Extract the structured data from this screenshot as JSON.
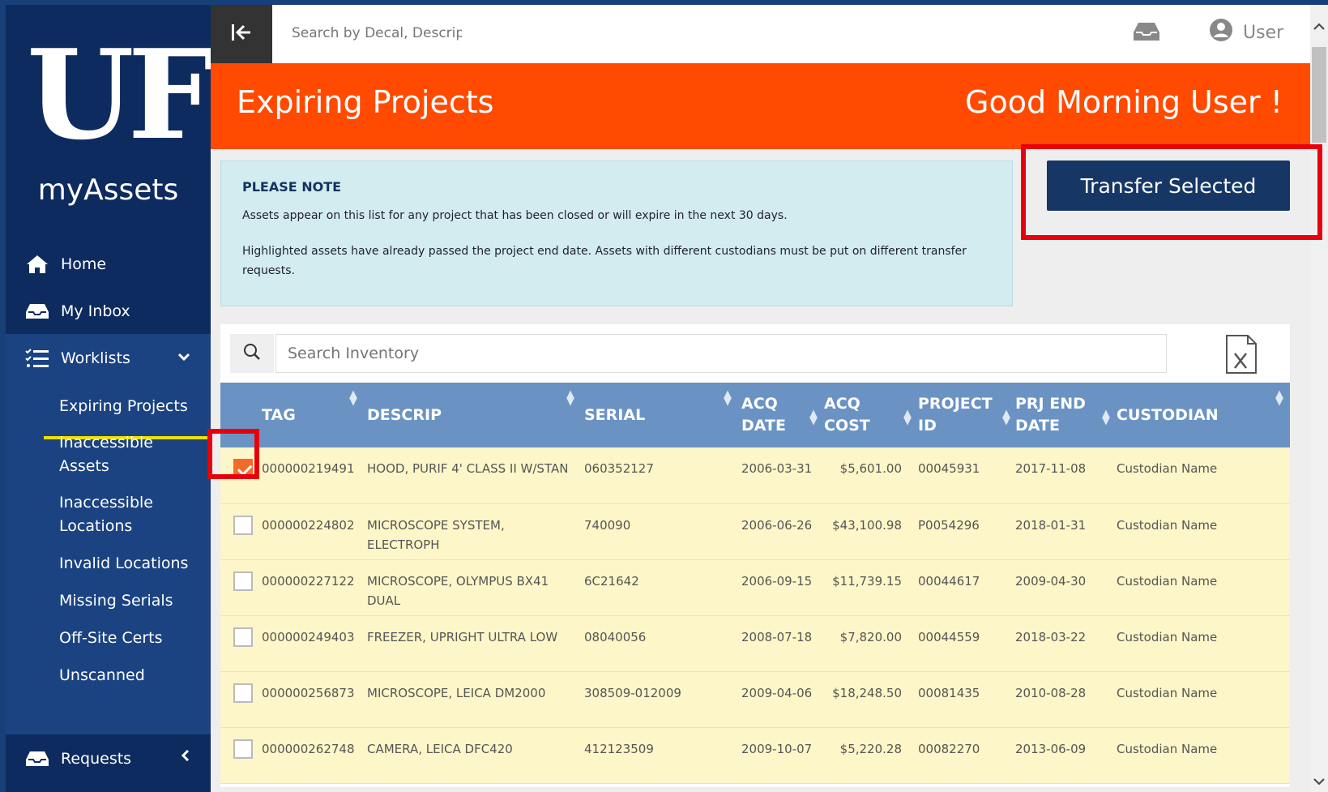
{
  "brand": {
    "logo": "UF",
    "app_name": "myAssets"
  },
  "nav": {
    "home": "Home",
    "inbox": "My Inbox",
    "worklists": "Worklists",
    "worklists_sub": [
      "Expiring Projects",
      "Inaccessible Assets",
      "Inaccessible Locations",
      "Invalid Locations",
      "Missing Serials",
      "Off-Site Certs",
      "Unscanned"
    ],
    "requests": "Requests"
  },
  "topbar": {
    "search_placeholder": "Search by Decal, Descript",
    "user_label": "User"
  },
  "header": {
    "title": "Expiring Projects",
    "greeting": "Good Morning User !"
  },
  "note": {
    "title": "PLEASE NOTE",
    "line1": "Assets appear on this list for any project that has been closed or will expire in the next 30 days.",
    "line2": "Highlighted assets have already passed the project end date. Assets with different custodians must be put on different transfer requests."
  },
  "actions": {
    "transfer_selected": "Transfer Selected"
  },
  "inventory": {
    "search_placeholder": "Search Inventory",
    "columns": [
      "TAG",
      "DESCRIP",
      "SERIAL",
      "ACQ DATE",
      "ACQ COST",
      "PROJECT ID",
      "PRJ END DATE",
      "CUSTODIAN"
    ],
    "rows": [
      {
        "checked": true,
        "tag": "000000219491",
        "descrip": "HOOD, PURIF 4' CLASS II W/STAN",
        "serial": "060352127",
        "acq_date": "2006-03-31",
        "acq_cost": "$5,601.00",
        "project_id": "00045931",
        "prj_end_date": "2017-11-08",
        "custodian": "Custodian Name"
      },
      {
        "checked": false,
        "tag": "000000224802",
        "descrip": "MICROSCOPE SYSTEM, ELECTROPH",
        "serial": "740090",
        "acq_date": "2006-06-26",
        "acq_cost": "$43,100.98",
        "project_id": "P0054296",
        "prj_end_date": "2018-01-31",
        "custodian": "Custodian Name"
      },
      {
        "checked": false,
        "tag": "000000227122",
        "descrip": "MICROSCOPE, OLYMPUS BX41 DUAL",
        "serial": "6C21642",
        "acq_date": "2006-09-15",
        "acq_cost": "$11,739.15",
        "project_id": "00044617",
        "prj_end_date": "2009-04-30",
        "custodian": "Custodian Name"
      },
      {
        "checked": false,
        "tag": "000000249403",
        "descrip": "FREEZER, UPRIGHT ULTRA LOW",
        "serial": "08040056",
        "acq_date": "2008-07-18",
        "acq_cost": "$7,820.00",
        "project_id": "00044559",
        "prj_end_date": "2018-03-22",
        "custodian": "Custodian Name"
      },
      {
        "checked": false,
        "tag": "000000256873",
        "descrip": "MICROSCOPE, LEICA DM2000",
        "serial": "308509-012009",
        "acq_date": "2009-04-06",
        "acq_cost": "$18,248.50",
        "project_id": "00081435",
        "prj_end_date": "2010-08-28",
        "custodian": "Custodian Name"
      },
      {
        "checked": false,
        "tag": "000000262748",
        "descrip": "CAMERA, LEICA DFC420",
        "serial": "412123509",
        "acq_date": "2009-10-07",
        "acq_cost": "$5,220.28",
        "project_id": "00082270",
        "prj_end_date": "2013-06-09",
        "custodian": "Custodian Name"
      }
    ]
  },
  "colors": {
    "brand_orange": "#ff4a00",
    "sidebar_navy": "#0d2b5e",
    "table_header": "#6a93c4",
    "highlight_row": "#fdf6c8",
    "callout_red": "#e8000b"
  }
}
